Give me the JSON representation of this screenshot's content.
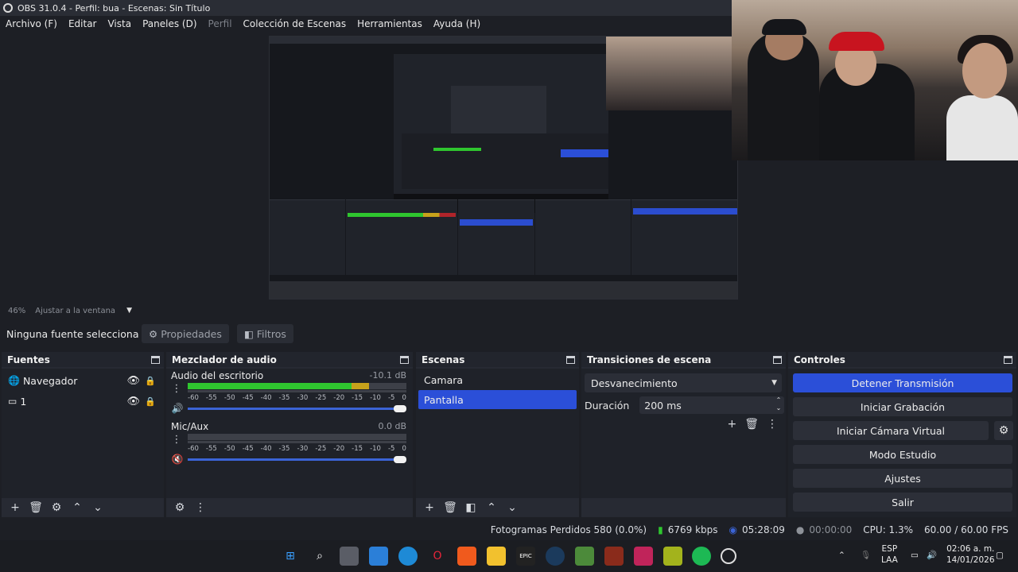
{
  "window": {
    "title": "OBS 31.0.4 - Perfil: bua - Escenas: Sin Título"
  },
  "menu": [
    {
      "label": "Archivo (F)",
      "enabled": true
    },
    {
      "label": "Editar",
      "enabled": true
    },
    {
      "label": "Vista",
      "enabled": true
    },
    {
      "label": "Paneles (D)",
      "enabled": true
    },
    {
      "label": "Perfil",
      "enabled": false
    },
    {
      "label": "Colección de Escenas",
      "enabled": true
    },
    {
      "label": "Herramientas",
      "enabled": true
    },
    {
      "label": "Ayuda (H)",
      "enabled": true
    }
  ],
  "zoom": {
    "percent": "46%",
    "fit_label": "Ajustar a la ventana"
  },
  "context_bar": {
    "no_source": "Ninguna fuente selecciona",
    "properties": "Propiedades",
    "filters": "Filtros"
  },
  "sources": {
    "title": "Fuentes",
    "items": [
      {
        "name": "Navegador",
        "icon": "globe-icon",
        "visible": true,
        "locked": false
      },
      {
        "name": "1",
        "icon": "monitor-icon",
        "visible": true,
        "locked": false
      }
    ]
  },
  "mixer": {
    "title": "Mezclador de audio",
    "scale": [
      "-60",
      "-55",
      "-50",
      "-45",
      "-40",
      "-35",
      "-30",
      "-25",
      "-20",
      "-15",
      "-10",
      "-5",
      "0"
    ],
    "channels": [
      {
        "name": "Audio del escritorio",
        "db": "-10.1 dB",
        "level": 0.83,
        "volume": 1.0,
        "muted": false
      },
      {
        "name": "Mic/Aux",
        "db": "0.0 dB",
        "level": 0.0,
        "volume": 1.0,
        "muted": true
      }
    ]
  },
  "scenes": {
    "title": "Escenas",
    "items": [
      {
        "name": "Camara",
        "selected": false
      },
      {
        "name": "Pantalla",
        "selected": true
      }
    ]
  },
  "transitions": {
    "title": "Transiciones de escena",
    "selected": "Desvanecimiento",
    "duration_label": "Duración",
    "duration_value": "200 ms"
  },
  "controls": {
    "title": "Controles",
    "buttons": {
      "stop_stream": "Detener Transmisión",
      "start_record": "Iniciar Grabación",
      "start_virtualcam": "Iniciar Cámara Virtual",
      "studio_mode": "Modo Estudio",
      "settings": "Ajustes",
      "exit": "Salir"
    }
  },
  "status": {
    "dropped_frames": "Fotogramas Perdidos 580 (0.0%)",
    "bitrate": "6769 kbps",
    "stream_time": "05:28:09",
    "record_time": "00:00:00",
    "cpu": "CPU: 1.3%",
    "fps": "60.00 / 60.00 FPS"
  },
  "tray": {
    "lang": "ESP",
    "layout": "LAA",
    "time": "02:06 a. m.",
    "date": "14/01/2026"
  },
  "colors": {
    "accent": "#2b4fd8",
    "meter_green": "#2fc62f",
    "meter_yellow": "#c7a21b",
    "meter_red": "#b0242a"
  }
}
